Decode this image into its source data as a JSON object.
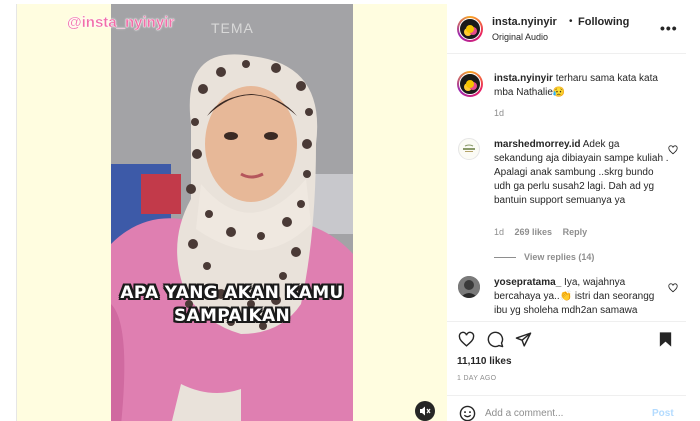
{
  "media": {
    "watermark": "@insta_nyinyir",
    "brand": "TEMA",
    "caption_line1": "APA YANG AKAN KAMU",
    "caption_line2": "SAMPAIKAN"
  },
  "header": {
    "username": "insta.nyinyir",
    "separator": "•",
    "follow_label": "Following",
    "audio": "Original Audio",
    "more_label": "•••"
  },
  "post": {
    "username": "insta.nyinyir",
    "caption": "terharu sama kata kata mba Nathalie😥",
    "time": "1d"
  },
  "comments": [
    {
      "username": "marshedmorrey.id",
      "text": "Adek ga sekandung aja dibiayain sampe kuliah . Apalagi anak sambung ..skrg bundo udh ga perlu susah2 lagi. Dah ad yg bantuin support semuanya ya",
      "time": "1d",
      "likes": "269 likes",
      "reply_label": "Reply",
      "view_replies": "View replies (14)"
    },
    {
      "username": "yosepratama_",
      "text": "Iya, wajahnya bercahaya ya..👏 istri dan seorangg ibu yg sholeha mdh2an samawa"
    }
  ],
  "actions": {
    "likes": "11,110 likes",
    "ago": "1 DAY AGO"
  },
  "add_comment": {
    "placeholder": "Add a comment...",
    "post_label": "Post"
  },
  "colors": {
    "media_bg": "#fffde0",
    "pink_text": "#f26ea8",
    "post_button": "#b3dbff"
  }
}
